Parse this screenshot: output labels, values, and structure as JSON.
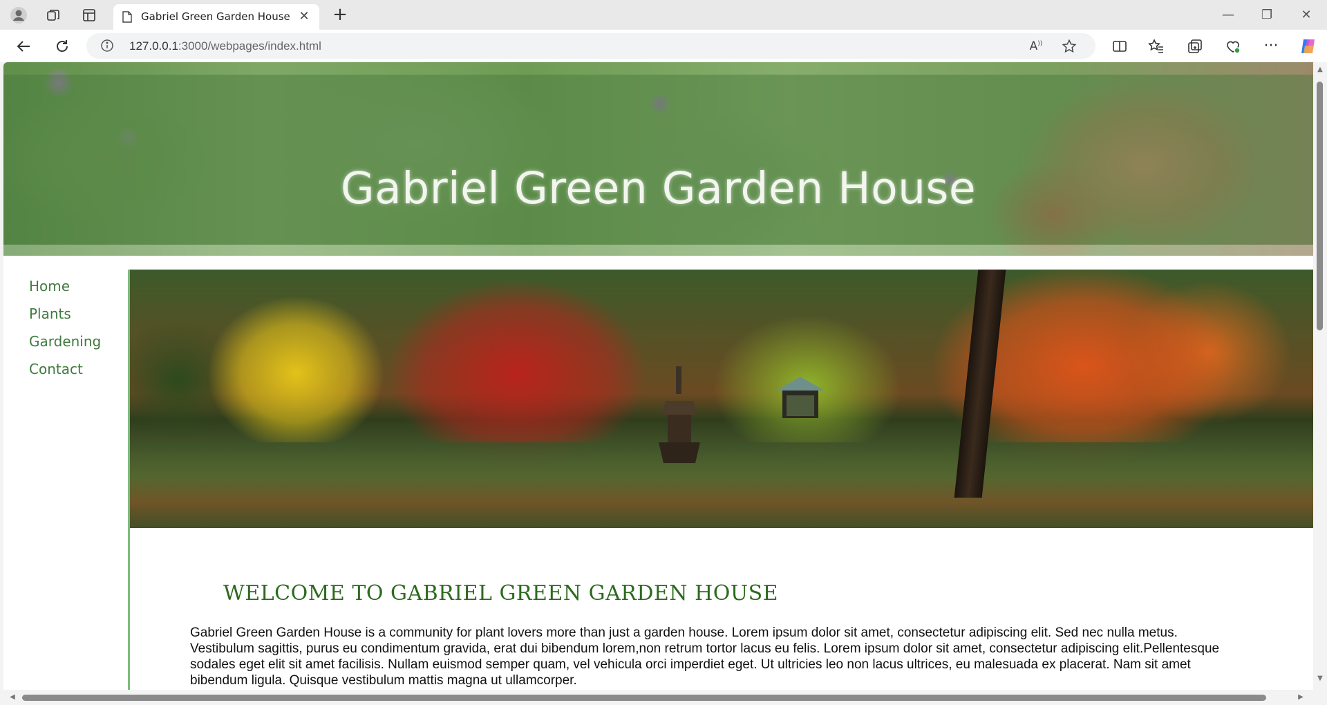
{
  "browser": {
    "tab_title": "Gabriel Green Garden House",
    "url_host": "127.0.0.1",
    "url_path": ":3000/webpages/index.html"
  },
  "page": {
    "site_title": "Gabriel Green Garden House",
    "nav": [
      {
        "label": "Home"
      },
      {
        "label": "Plants"
      },
      {
        "label": "Gardening"
      },
      {
        "label": "Contact"
      }
    ],
    "welcome_heading": "WELCOME TO GABRIEL GREEN GARDEN HOUSE",
    "intro_text": "Gabriel Green Garden House is a community for plant lovers more than just a garden house. Lorem ipsum dolor sit amet, consectetur adipiscing elit. Sed nec nulla metus. Vestibulum sagittis, purus eu condimentum gravida, erat dui bibendum lorem,non retrum tortor lacus eu felis. Lorem ipsum dolor sit amet, consectetur adipiscing elit.Pellentesque sodales eget elit sit amet facilisis. Nullam euismod semper quam, vel vehicula orci imperdiet eget. Ut ultricies leo non lacus ultrices, eu malesuada ex placerat. Nam sit amet bibendum ligula. Quisque vestibulum mattis magna ut ullamcorper."
  },
  "colors": {
    "nav_link": "#3f7a3f",
    "heading": "#2d6a1f",
    "content_border": "#7dbb7d"
  },
  "icons": [
    "profile-icon",
    "workspaces-icon",
    "tab-actions-icon",
    "page-icon",
    "close-icon",
    "plus-icon",
    "minimize-icon",
    "restore-icon",
    "window-close-icon",
    "back-icon",
    "reload-icon",
    "info-icon",
    "read-aloud-icon",
    "favorite-star-icon",
    "split-screen-icon",
    "favorites-icon",
    "collections-icon",
    "browser-essentials-icon",
    "more-icon",
    "copilot-icon"
  ]
}
